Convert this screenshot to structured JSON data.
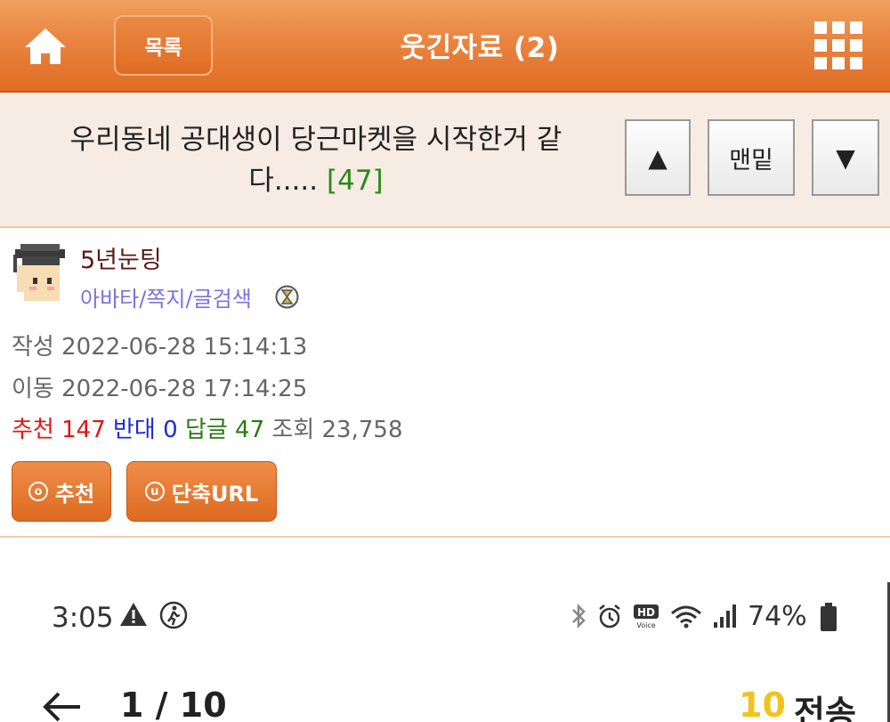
{
  "header": {
    "home_icon": "home-icon",
    "list_label": "목록",
    "title": "웃긴자료 (2)",
    "menu_icon": "grid-menu-icon",
    "colors": {
      "bar": "#e98440",
      "text": "#ffffff"
    }
  },
  "post": {
    "title": "우리동네 공대생이 당근마켓을 시작한거 같다.....",
    "comment_count": "[47]",
    "nav": {
      "up": "▲",
      "bottom": "맨밑",
      "down": "▼"
    }
  },
  "author": {
    "name": "5년눈팅",
    "links": "아바타/쪽지/글검색",
    "avatar_icon": "graduate-avatar-icon",
    "badge_icon": "hourglass-badge-icon"
  },
  "meta": {
    "written_label": "작성",
    "written": "2022-06-28 15:14:13",
    "moved_label": "이동",
    "moved": "2022-06-28 17:14:25"
  },
  "stats": {
    "recommend_label": "추천",
    "recommend": "147",
    "oppose_label": "반대",
    "oppose": "0",
    "reply_label": "답글",
    "reply": "47",
    "views_label": "조회",
    "views": "23,758",
    "colors": {
      "recommend": "#e01515",
      "oppose": "#1a2bd6",
      "reply": "#2a7a14"
    }
  },
  "actions": {
    "recommend_label": "추천",
    "recommend_icon": "ⓞ",
    "shorturl_label": "단축URL",
    "shorturl_icon": "ⓤ"
  },
  "screenshot": {
    "time": "3:05",
    "battery": "74%",
    "pager": "1 / 10",
    "send_count": "10",
    "send_label": "전송",
    "status_icons": [
      "warning-icon",
      "walking-icon",
      "bluetooth-icon",
      "alarm-icon",
      "hd-voice-icon",
      "wifi-icon",
      "signal-icon",
      "battery-icon"
    ]
  }
}
